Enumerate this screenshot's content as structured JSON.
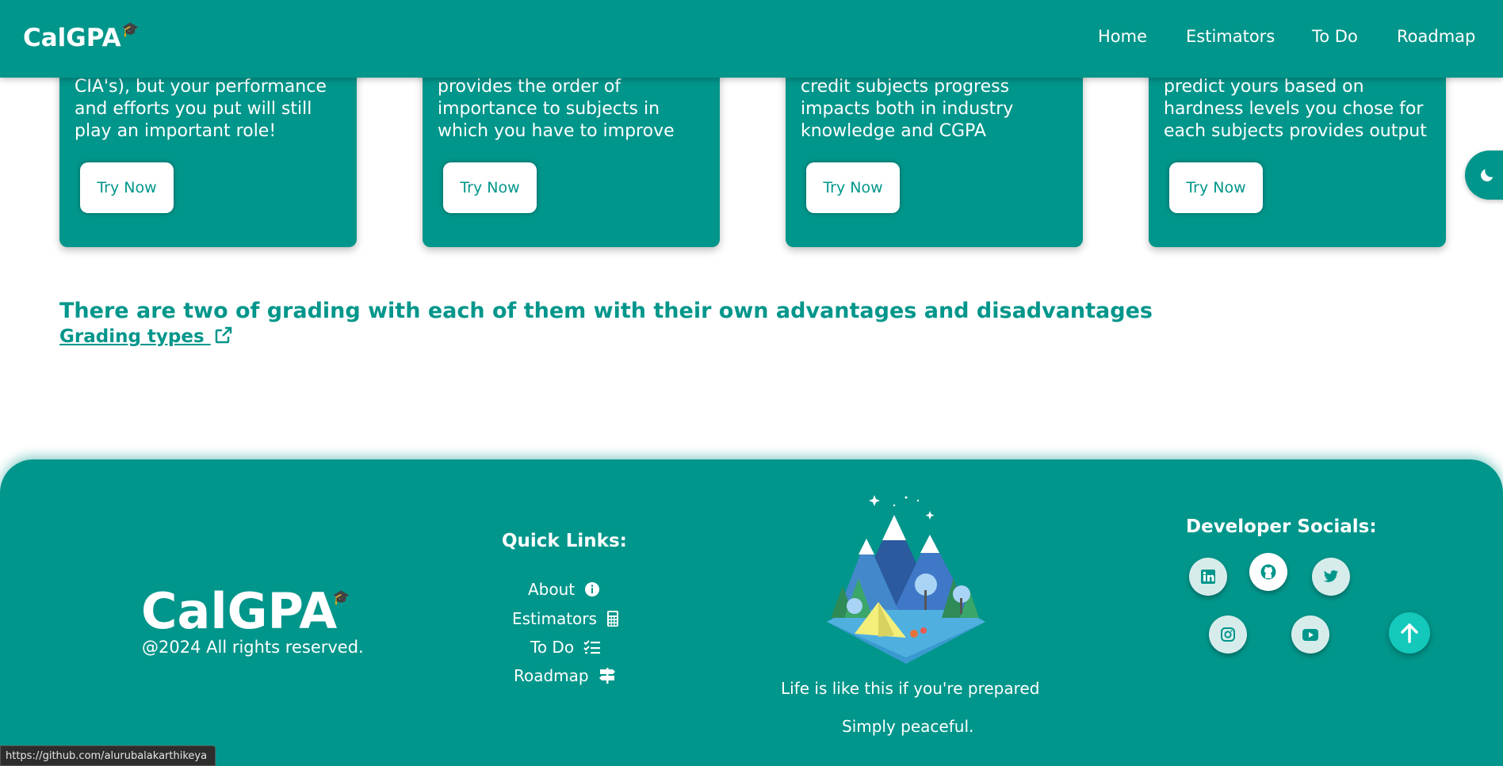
{
  "nav": {
    "brand": "CalGPA",
    "links": [
      "Home",
      "Estimators",
      "To Do",
      "Roadmap"
    ]
  },
  "cards": [
    {
      "lines": [
        "CIA's), but your performance",
        "and efforts you put will still",
        "play an important role!"
      ],
      "button": "Try Now"
    },
    {
      "lines": [
        "provides the order of",
        "importance to subjects in",
        "which you have to improve"
      ],
      "button": "Try Now"
    },
    {
      "lines": [
        "credit subjects progress",
        "impacts both in industry",
        "knowledge and CGPA"
      ],
      "button": "Try Now"
    },
    {
      "lines": [
        "predict yours based on",
        "hardness levels you chose for",
        "each subjects provides output"
      ],
      "button": "Try Now"
    }
  ],
  "grading": {
    "heading": "There are two of grading with each of them with their own advantages and disadvantages",
    "link": "Grading types"
  },
  "footer": {
    "brand": "CalGPA",
    "rights": "@2024 All rights reserved.",
    "quick_links_title": "Quick Links:",
    "quick_links": [
      "About",
      "Estimators",
      "To Do",
      "Roadmap"
    ],
    "caption1": "Life is like this if you're prepared",
    "caption2": "Simply peaceful.",
    "socials_title": "Developer Socials:",
    "socials": [
      "linkedin-icon",
      "github-icon",
      "twitter-icon",
      "instagram-icon",
      "youtube-icon"
    ]
  },
  "status_url": "https://github.com/alurubalakarthikeya",
  "colors": {
    "primary": "#01968b",
    "accent": "#14c8bb",
    "white": "#ffffff"
  }
}
